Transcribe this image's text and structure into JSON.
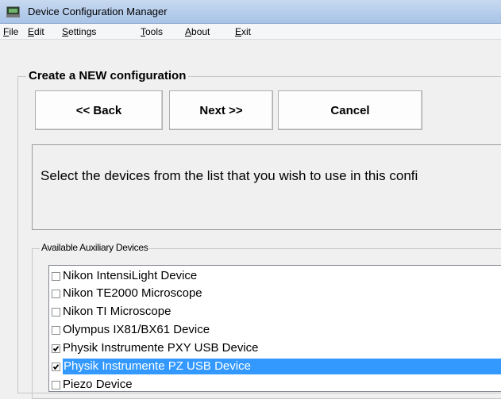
{
  "window": {
    "title": "Device Configuration Manager"
  },
  "menu": [
    {
      "acc": "F",
      "rest": "ile"
    },
    {
      "acc": "E",
      "rest": "dit"
    },
    {
      "acc": "S",
      "rest": "ettings"
    },
    {
      "acc": "T",
      "rest": "ools"
    },
    {
      "acc": "A",
      "rest": "bout"
    },
    {
      "acc": "E",
      "rest": "xit"
    }
  ],
  "wizard": {
    "group_title": "Create a NEW configuration",
    "back_label": "<< Back",
    "next_label": "Next >>",
    "cancel_label": "Cancel",
    "instruction": "Select the devices from the list that you wish to use in this confi"
  },
  "aux": {
    "group_title": "Available Auxiliary Devices",
    "devices": [
      {
        "label": "Nikon IntensiLight Device",
        "checked": false,
        "selected": false
      },
      {
        "label": "Nikon TE2000 Microscope",
        "checked": false,
        "selected": false
      },
      {
        "label": "Nikon TI Microscope",
        "checked": false,
        "selected": false
      },
      {
        "label": "Olympus IX81/BX61 Device",
        "checked": false,
        "selected": false
      },
      {
        "label": "Physik Instrumente PXY USB Device",
        "checked": true,
        "selected": false
      },
      {
        "label": "Physik Instrumente PZ USB Device",
        "checked": true,
        "selected": true
      },
      {
        "label": "Piezo Device",
        "checked": false,
        "selected": false
      }
    ]
  },
  "colors": {
    "selection": "#3399ff",
    "titlebar": "#b9cfec"
  }
}
